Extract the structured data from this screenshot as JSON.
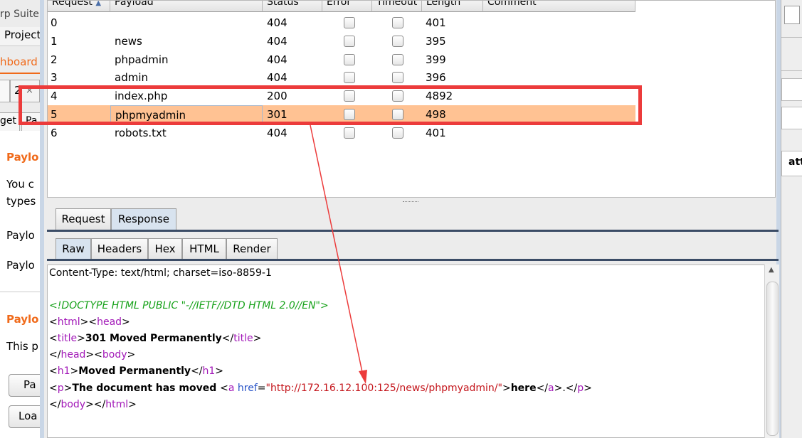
{
  "left_window": {
    "title_fragment": "rp Suite",
    "menu_fragment": "Project",
    "dashboard_fragment": "hboard",
    "tab_fragment": "2",
    "close_glyph": "×",
    "subtab_fragment_1": "get",
    "subtab_fragment_2": "Pa",
    "section1_title": "Paylo",
    "text1": "You c",
    "text2": "types",
    "payload_label_1": "Paylo",
    "payload_label_2": "Paylo",
    "section2_title": "Paylo",
    "text3": "This p",
    "button1": "Pa",
    "button2": "Loa"
  },
  "right_window": {
    "text_fragment": "att"
  },
  "results_table": {
    "columns": [
      "Request",
      "Payload",
      "Status",
      "Error",
      "Timeout",
      "Length",
      "Comment"
    ],
    "sort_indicator": "▲",
    "rows": [
      {
        "request": "0",
        "payload": "",
        "status": "404",
        "length": "401"
      },
      {
        "request": "1",
        "payload": "news",
        "status": "404",
        "length": "395"
      },
      {
        "request": "2",
        "payload": "phpadmin",
        "status": "404",
        "length": "399"
      },
      {
        "request": "3",
        "payload": "admin",
        "status": "404",
        "length": "396"
      },
      {
        "request": "4",
        "payload": "index.php",
        "status": "200",
        "length": "4892"
      },
      {
        "request": "5",
        "payload": "phpmyadmin",
        "status": "301",
        "length": "498"
      },
      {
        "request": "6",
        "payload": "robots.txt",
        "status": "404",
        "length": "401"
      }
    ],
    "selected_row": "5"
  },
  "message_tabs": [
    "Request",
    "Response"
  ],
  "view_tabs": [
    "Raw",
    "Headers",
    "Hex",
    "HTML",
    "Render"
  ],
  "response": {
    "content_type": "Content-Type: text/html; charset=iso-8859-1",
    "doctype": "<!DOCTYPE HTML PUBLIC \"-//IETF//DTD HTML 2.0//EN\">",
    "title_text": "301 Moved Permanently",
    "h1_text": "Moved Permanently",
    "p_text": "The document has moved ",
    "href_attr": "href",
    "href_value": "\"http://172.16.12.100:125/news/phpmyadmin/\"",
    "link_text": "here"
  },
  "colors": {
    "selection": "#ffc293",
    "annotation_red": "#ec3b3b",
    "comment_green": "#17a21a",
    "tag_purple": "#a218b8",
    "string_red": "#c4161c"
  }
}
